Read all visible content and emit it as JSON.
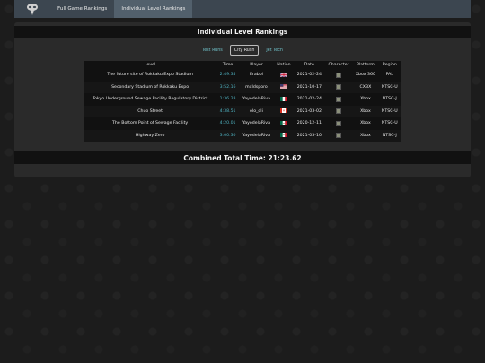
{
  "nav": {
    "logo_icon": "alien-logo-icon",
    "tabs": [
      {
        "label": "Full Game Rankings",
        "active": false
      },
      {
        "label": "Individual Level Rankings",
        "active": true
      }
    ]
  },
  "page": {
    "title": "Individual Level Rankings",
    "filters": [
      {
        "label": "Test Runs",
        "active": false
      },
      {
        "label": "City Rush",
        "active": true
      },
      {
        "label": "Jet Tech",
        "active": false
      }
    ],
    "total_label": "Combined Total Time: 21:23.62"
  },
  "table": {
    "headers": [
      "Level",
      "Time",
      "Player",
      "Nation",
      "Date",
      "Character",
      "Platform",
      "Region"
    ],
    "rows": [
      {
        "level": "The future site of Rokkaku Expo Stadium",
        "time": "2:49.35",
        "player": "Erabbi",
        "nation": "uk",
        "date": "2021-02-24",
        "character": "sonic",
        "platform": "Xbox 360",
        "region": "PAL"
      },
      {
        "level": "Secondary Stadium of Rokkaku Expo",
        "time": "3:52.16",
        "player": "mxldsporo",
        "nation": "us",
        "date": "2021-10-17",
        "character": "knuckles",
        "platform": "CXBX",
        "region": "NTSC-U"
      },
      {
        "level": "Tokyo Underground Sewage Facility Regulatory District",
        "time": "1:36.28",
        "player": "YayodelaRiva",
        "nation": "mx",
        "date": "2021-02-24",
        "character": "knuckles",
        "platform": "Xbox",
        "region": "NTSC-J"
      },
      {
        "level": "Chuo Street",
        "time": "4:38.51",
        "player": "olo_oli",
        "nation": "ca",
        "date": "2021-03-02",
        "character": "knuckles",
        "platform": "Xbox",
        "region": "NTSC-U"
      },
      {
        "level": "The Bottom Point of Sewage Facility",
        "time": "4:20.01",
        "player": "YayodelaRiva",
        "nation": "mx",
        "date": "2020-12-11",
        "character": "knuckles",
        "platform": "Xbox",
        "region": "NTSC-U"
      },
      {
        "level": "Highway Zero",
        "time": "3:00.30",
        "player": "YayodelaRiva",
        "nation": "mx",
        "date": "2021-03-10",
        "character": "knuckles",
        "platform": "Xbox",
        "region": "NTSC-J"
      }
    ]
  },
  "colors": {
    "time": "#4fb3c2",
    "nav_bg": "#3c4650",
    "nav_active": "#52606c",
    "panel_bg": "#2a2a2a"
  }
}
